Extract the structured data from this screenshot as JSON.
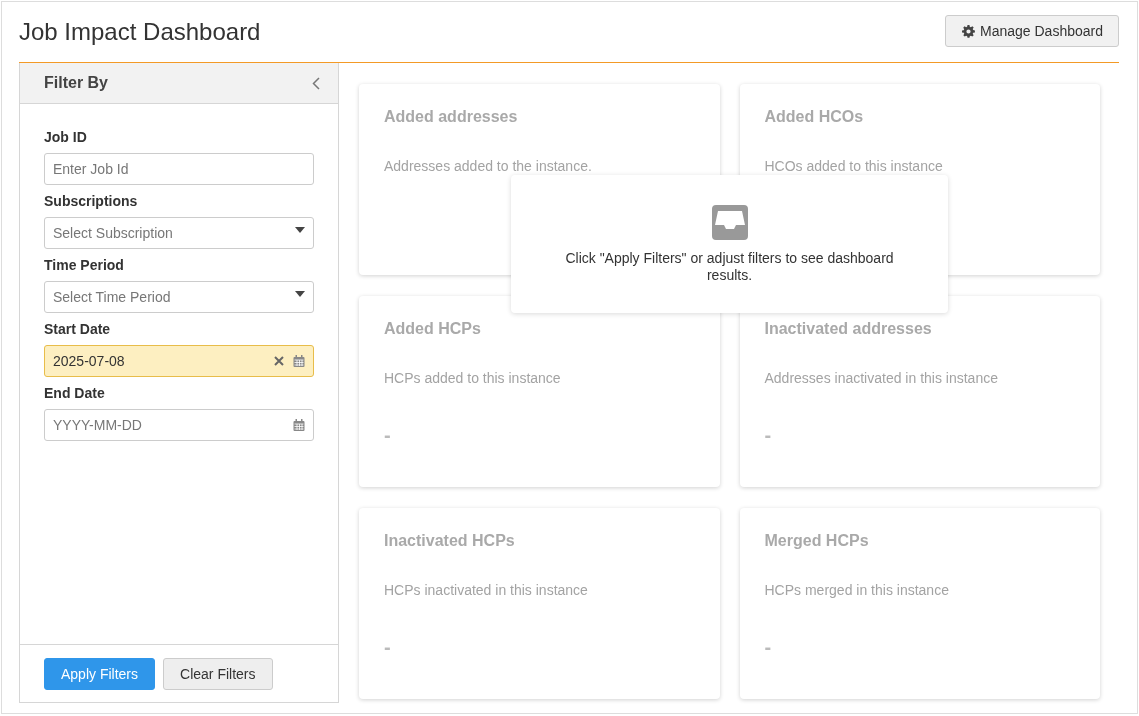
{
  "page": {
    "title": "Job Impact Dashboard",
    "manage_button": "Manage Dashboard"
  },
  "filter_panel": {
    "title": "Filter By",
    "fields": [
      {
        "label": "Job ID",
        "kind": "text",
        "placeholder": "Enter Job Id"
      },
      {
        "label": "Subscriptions",
        "kind": "select",
        "placeholder": "Select Subscription"
      },
      {
        "label": "Time Period",
        "kind": "select",
        "placeholder": "Select Time Period"
      },
      {
        "label": "Start Date",
        "kind": "date",
        "value": "2025-07-08"
      },
      {
        "label": "End Date",
        "kind": "date",
        "placeholder": "YYYY-MM-DD"
      }
    ],
    "buttons": [
      {
        "label": "Apply Filters",
        "kind": "primary"
      },
      {
        "label": "Clear Filters",
        "kind": "secondary"
      }
    ]
  },
  "cards": [
    {
      "title": "Added addresses",
      "description": "Addresses added to the instance."
    },
    {
      "title": "Added HCOs",
      "description": "HCOs added to this instance"
    },
    {
      "title": "Added HCPs",
      "description": "HCPs added to this instance",
      "value": "-"
    },
    {
      "title": "Inactivated addresses",
      "description": "Addresses inactivated in this instance",
      "value": "-"
    },
    {
      "title": "Inactivated HCPs",
      "description": "HCPs inactivated in this instance",
      "value": "-"
    },
    {
      "title": "Merged HCPs",
      "description": "HCPs merged in this instance",
      "value": "-"
    }
  ],
  "empty_state": {
    "message": "Click \"Apply Filters\" or adjust filters to see dashboard results."
  }
}
